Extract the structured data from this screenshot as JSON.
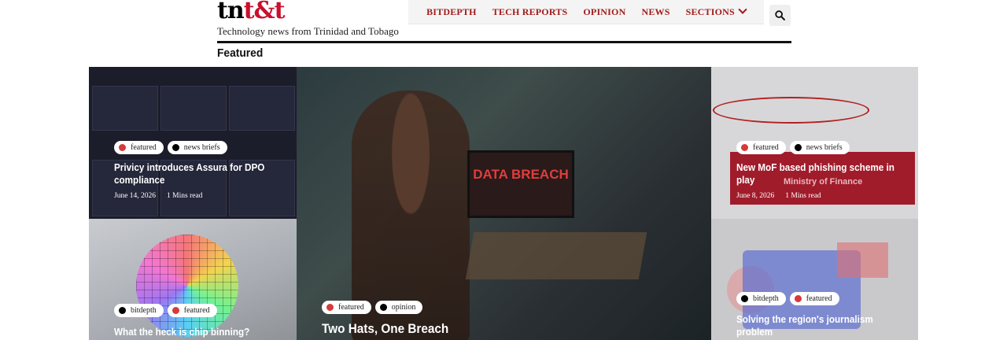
{
  "site": {
    "logo_part1": "tn",
    "logo_part2": "t&t",
    "tagline": "Technology news from Trinidad and Tobago"
  },
  "nav": {
    "items": [
      "BITDEPTH",
      "TECH REPORTS",
      "OPINION",
      "NEWS",
      "SECTIONS"
    ],
    "search_icon": "search-icon"
  },
  "section_title": "Featured",
  "cards": [
    {
      "tags": [
        {
          "label": "featured",
          "color": "red"
        },
        {
          "label": "news briefs",
          "color": "black"
        }
      ],
      "title": "Privicy introduces Assura for DPO compliance",
      "date": "June 14, 2026",
      "read": "1 Mins read"
    },
    {
      "tags": [
        {
          "label": "bitdepth",
          "color": "black"
        },
        {
          "label": "featured",
          "color": "red"
        }
      ],
      "title": "What the heck is chip binning?"
    },
    {
      "tags": [
        {
          "label": "featured",
          "color": "red"
        },
        {
          "label": "opinion",
          "color": "black"
        }
      ],
      "title": "Two Hats, One Breach",
      "image_text": "DATA BREACH"
    },
    {
      "tags": [
        {
          "label": "featured",
          "color": "red"
        },
        {
          "label": "news briefs",
          "color": "black"
        }
      ],
      "title": "New MoF based phishing scheme in play",
      "date": "June 8, 2026",
      "read": "1 Mins read",
      "image_text": "Ministry of Finance"
    },
    {
      "tags": [
        {
          "label": "bitdepth",
          "color": "black"
        },
        {
          "label": "featured",
          "color": "red"
        }
      ],
      "title": "Solving the region's journalism problem"
    }
  ],
  "colors": {
    "brand_red": "#c8102e",
    "nav_red": "#a11b1b"
  }
}
